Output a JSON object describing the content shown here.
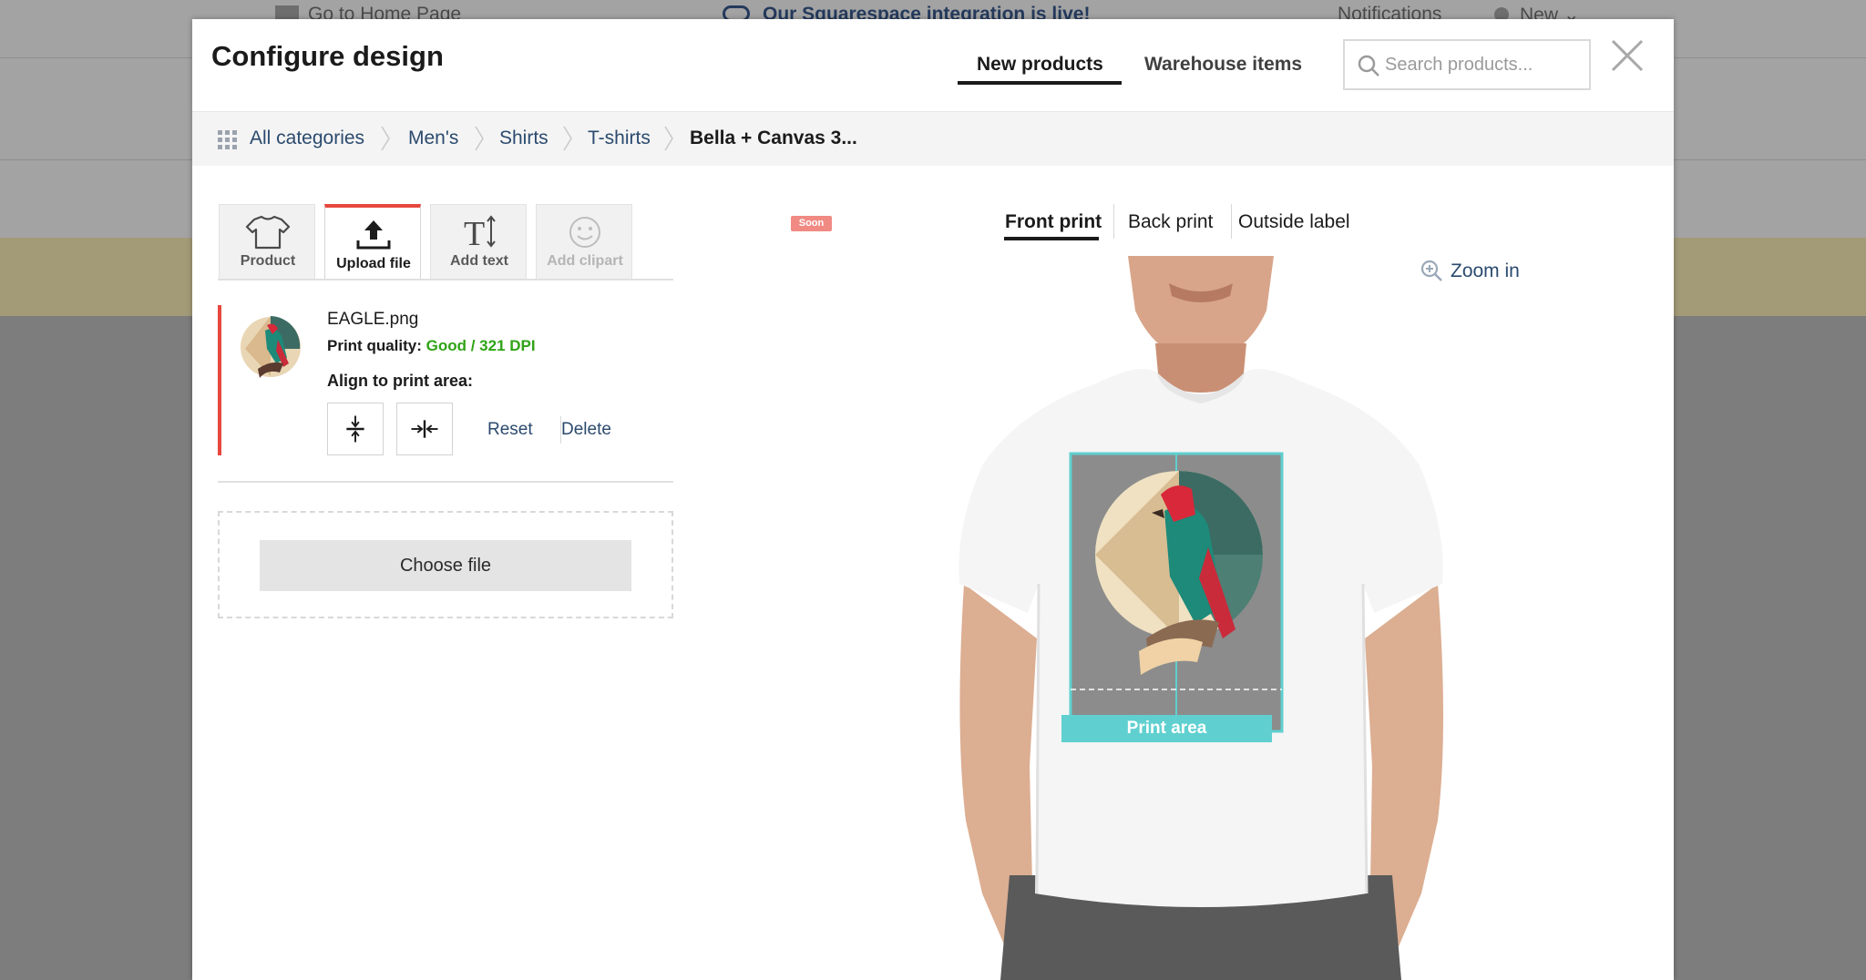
{
  "background": {
    "home_link": "Go to Home Page",
    "announcement": "Our Squarespace integration is live!",
    "notifications": "Notifications",
    "new_menu": "New"
  },
  "modal": {
    "title": "Configure design",
    "tabs": [
      {
        "label": "New products",
        "active": true
      },
      {
        "label": "Warehouse items",
        "active": false
      }
    ],
    "search": {
      "placeholder": "Search products..."
    }
  },
  "breadcrumb": [
    "All categories",
    "Men's",
    "Shirts",
    "T-shirts",
    "Bella + Canvas 3..."
  ],
  "tools": [
    {
      "label": "Product",
      "icon": "tshirt-icon"
    },
    {
      "label": "Upload file",
      "icon": "upload-icon",
      "active": true
    },
    {
      "label": "Add text",
      "icon": "text-icon"
    },
    {
      "label": "Add clipart",
      "icon": "smiley-icon",
      "disabled": true,
      "badge": "Soon"
    }
  ],
  "file": {
    "name": "EAGLE.png",
    "quality_label": "Print quality:",
    "quality_value": "Good / 321 DPI",
    "align_label": "Align to print area:",
    "reset": "Reset",
    "delete": "Delete",
    "choose": "Choose file"
  },
  "print_sides": [
    {
      "label": "Front print",
      "active": true
    },
    {
      "label": "Back print",
      "active": false
    },
    {
      "label": "Outside label",
      "active": false
    }
  ],
  "zoom_label": "Zoom in",
  "print_area_label": "Print area",
  "colors": {
    "accent": "#e8473e",
    "quality_good": "#2fa316",
    "print_area": "#5fd0cf",
    "link": "#2b4a6e"
  }
}
